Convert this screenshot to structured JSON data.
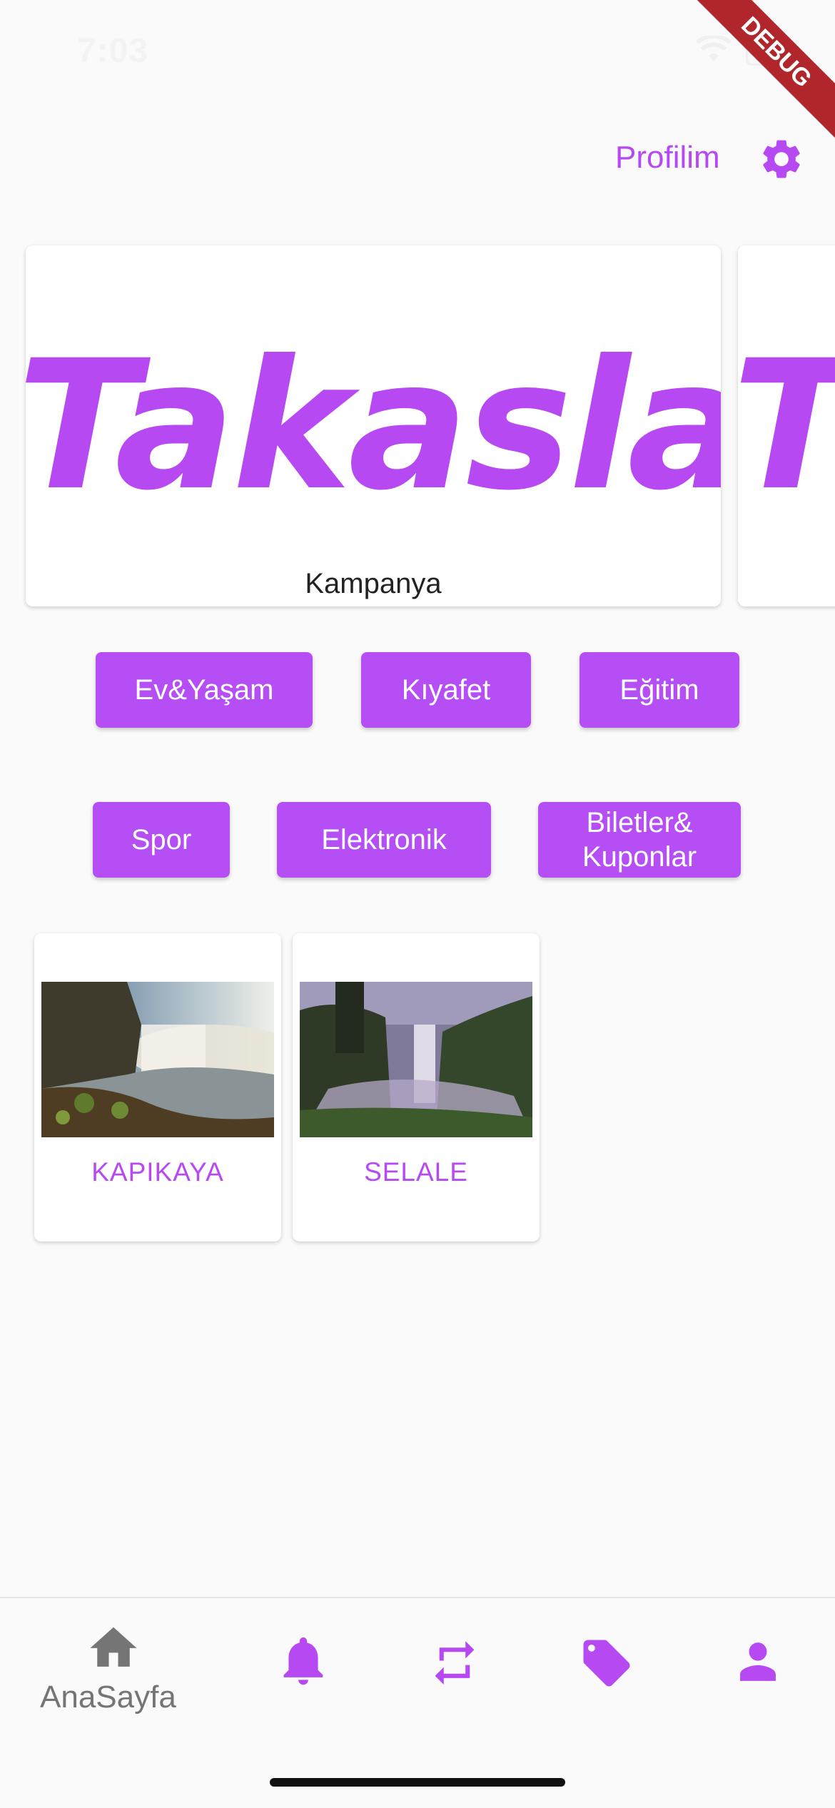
{
  "status_bar": {
    "time": "7:03"
  },
  "debug_banner": "DEBUG",
  "header": {
    "profile_label": "Profilim",
    "settings_icon": "gear-icon"
  },
  "carousel": {
    "items": [
      {
        "brand_text": "Takasla",
        "caption": "Kampanya"
      },
      {
        "brand_text": "T",
        "caption": ""
      }
    ]
  },
  "categories": [
    {
      "label": "Ev&Yaşam"
    },
    {
      "label": "Kıyafet"
    },
    {
      "label": "Eğitim"
    },
    {
      "label": "Spor"
    },
    {
      "label": "Elektronik"
    },
    {
      "label": "Biletler& Kuponlar"
    }
  ],
  "products": [
    {
      "name": "KAPIKAYA"
    },
    {
      "name": "SELALE"
    }
  ],
  "bottom_nav": {
    "items": [
      {
        "icon": "home-icon",
        "label": "AnaSayfa"
      },
      {
        "icon": "bell-icon",
        "label": ""
      },
      {
        "icon": "swap-icon",
        "label": ""
      },
      {
        "icon": "tag-icon",
        "label": ""
      },
      {
        "icon": "person-icon",
        "label": ""
      }
    ]
  },
  "colors": {
    "accent": "#b749f2",
    "button": "#b54ef5",
    "nav_inactive": "#757575"
  }
}
